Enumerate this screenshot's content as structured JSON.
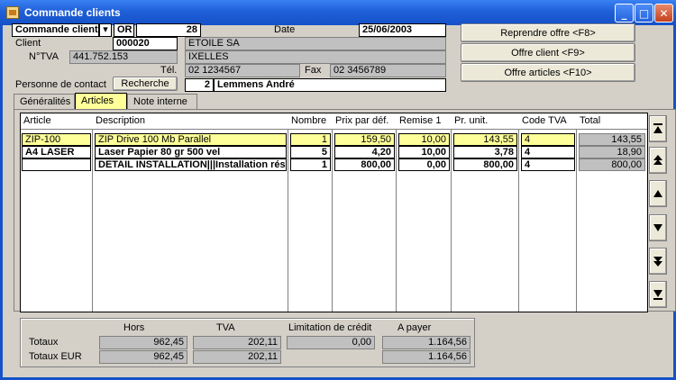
{
  "window": {
    "title": "Commande clients",
    "min": "_",
    "max": "□",
    "close": "✕"
  },
  "header": {
    "doc_type": "Commande client:",
    "doc_type_arrow": "▾",
    "prefix": "OR",
    "number": "28",
    "date_label": "Date",
    "date": "25/06/2003",
    "client_label": "Client",
    "client_code": "000020",
    "client_name": "ETOILE SA",
    "tva_label": "N°TVA",
    "tva_number": "441.752.153",
    "city": "IXELLES",
    "tel_label": "Tél.",
    "tel": "02 1234567",
    "fax_label": "Fax",
    "fax": "02 3456789",
    "contact_label": "Personne de contact",
    "search_button": "Recherche",
    "contact_number": "2",
    "contact_name": "Lemmens André"
  },
  "actions": {
    "reprendre": "Reprendre offre <F8>",
    "offre_client": "Offre client <F9>",
    "offre_articles": "Offre articles <F10>"
  },
  "tabs": [
    "Généralités",
    "Articles",
    "Note interne"
  ],
  "grid": {
    "columns": [
      "Article",
      "Description",
      "Nombre",
      "Prix par déf.",
      "Remise 1",
      "Pr. unit.",
      "Code TVA",
      "Total"
    ],
    "rows": [
      {
        "article": "ZIP-100",
        "description": "ZIP Drive 100 Mb Parallel",
        "nombre": "1",
        "prix": "159,50",
        "remise": "10,00",
        "unit": "143,55",
        "tva": "4",
        "total": "143,55"
      },
      {
        "article": "A4 LASER",
        "description": "Laser Papier 80 gr 500 vel",
        "nombre": "5",
        "prix": "4,20",
        "remise": "10,00",
        "unit": "3,78",
        "tva": "4",
        "total": "18,90"
      },
      {
        "article": "",
        "description": "DETAIL INSTALLATION|||Installation rés",
        "nombre": "1",
        "prix": "800,00",
        "remise": "0,00",
        "unit": "800,00",
        "tva": "4",
        "total": "800,00"
      }
    ]
  },
  "nav_icons": [
    "first-page-icon",
    "previous-page-icon",
    "previous-row-icon",
    "next-row-icon",
    "next-page-icon",
    "last-page-icon"
  ],
  "totals": {
    "headers": {
      "hors": "Hors",
      "tva": "TVA",
      "credit": "Limitation de crédit",
      "payer": "A payer"
    },
    "totaux_label": "Totaux",
    "totaux_eur_label": "Totaux EUR",
    "totaux": {
      "hors": "962,45",
      "tva": "202,11",
      "credit": "0,00",
      "payer": "1.164,56"
    },
    "totaux_eur": {
      "hors": "962,45",
      "tva": "202,11",
      "payer": "1.164,56"
    }
  }
}
